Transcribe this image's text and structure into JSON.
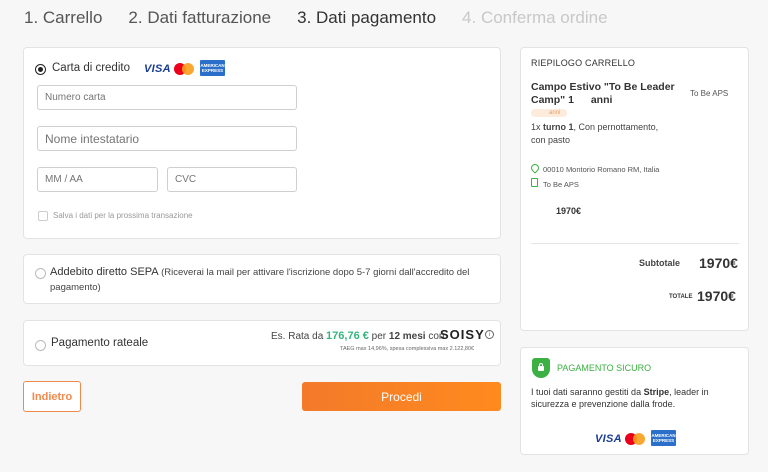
{
  "steps": [
    {
      "label": "1. Carrello"
    },
    {
      "label": "2. Dati fatturazione"
    },
    {
      "label": "3. Dati pagamento"
    },
    {
      "label": "4. Conferma ordine"
    }
  ],
  "payment": {
    "card": {
      "label": "Carta di credito",
      "brands": {
        "visa": "VISA",
        "amex": "AMERICAN EXPRESS"
      },
      "number_placeholder": "Numero carta",
      "holder_placeholder": "Nome intestatario",
      "expiry_placeholder": "MM / AA",
      "cvc_placeholder": "CVC",
      "save_label": "Salva i dati per la prossima transazione"
    },
    "sepa": {
      "label": "Addebito diretto SEPA",
      "note_line1": "(Riceverai la mail per attivare l'iscrizione dopo 5-7 giorni dall'accredito del",
      "note_line2": "pagamento)"
    },
    "installments": {
      "label": "Pagamento rateale",
      "rate_prefix": "Es. Rata da",
      "rate_amount": "176,76 €",
      "rate_per": "per",
      "rate_months": "12 mesi",
      "rate_with": "con",
      "provider": "SOISY",
      "fine_print": "TAEG max 14,96%, spesa complessiva max 2.122,80€"
    }
  },
  "actions": {
    "back_label": "Indietro",
    "proceed_label": "Procedi"
  },
  "summary": {
    "title": "RIEPILOGO CARRELLO",
    "item": {
      "name_line1": "Campo Estivo \"To Be Leader",
      "name_line2": "Camp\" 1",
      "name_line2_suffix": "anni",
      "badge": "anni",
      "organizer": "To Be APS",
      "qty_prefix": "1x",
      "turn": "turno 1",
      "details_line1": ", Con pernottamento,",
      "details_line2": "con pasto",
      "location": "00010 Montorio Romano RM, Italia",
      "org_line": "To Be APS",
      "price": "1970€"
    },
    "subtotal_label": "Subtotale",
    "subtotal_value": "1970€",
    "total_label": "TOTALE",
    "total_value": "1970€"
  },
  "secure": {
    "title": "PAGAMENTO SICURO",
    "text_line1_pre": "I tuoi dati saranno gestiti da",
    "text_line1_bold": "Stripe",
    "text_line1_post": ", leader in",
    "text_line2": "sicurezza e prevenzione dalla frode.",
    "brands": {
      "visa": "VISA",
      "amex": "AMERICAN EXPRESS"
    }
  },
  "colors": {
    "accent": "#f37a2a",
    "green": "#3cb043",
    "soisy_green": "#36b37e"
  }
}
